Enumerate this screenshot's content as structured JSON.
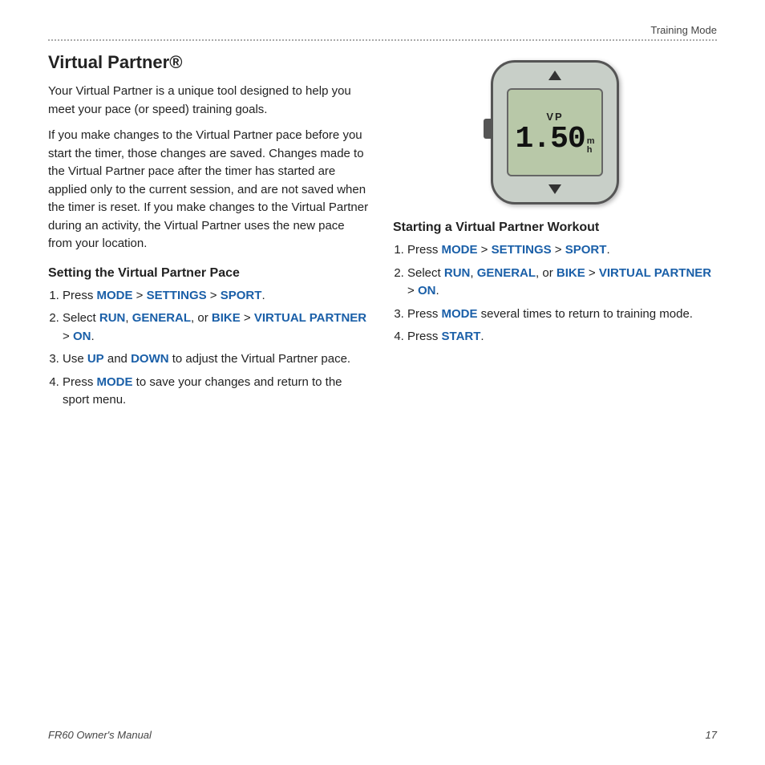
{
  "header": {
    "training_mode": "Training Mode"
  },
  "title": "Virtual Partner®",
  "intro_paragraphs": [
    "Your Virtual Partner is a unique tool designed to help you meet your pace (or speed) training goals.",
    "If you make changes to the Virtual Partner pace before you start the timer, those changes are saved. Changes made to the Virtual Partner pace after the timer has started are applied only to the current session, and are not saved when the timer is reset. If you make changes to the Virtual Partner during an activity, the Virtual Partner uses the new pace from your location."
  ],
  "section1": {
    "heading": "Setting the Virtual Partner Pace",
    "steps": [
      {
        "text_parts": [
          "Press ",
          "MODE",
          " > ",
          "SETTINGS",
          " > ",
          "SPORT",
          "."
        ]
      },
      {
        "text_parts": [
          "Select ",
          "RUN",
          ", ",
          "GENERAL",
          ", or ",
          "BIKE",
          " > ",
          "VIRTUAL PARTNER",
          " > ",
          "ON",
          "."
        ]
      },
      {
        "text_parts": [
          "Use ",
          "UP",
          " and ",
          "DOWN",
          " to adjust the Virtual Partner pace."
        ]
      },
      {
        "text_parts": [
          "Press ",
          "MODE",
          " to save your changes and return to the sport menu."
        ]
      }
    ]
  },
  "section2": {
    "heading": "Starting a Virtual Partner Workout",
    "steps": [
      {
        "text_parts": [
          "Press ",
          "MODE",
          " > ",
          "SETTINGS",
          " > ",
          "SPORT",
          "."
        ]
      },
      {
        "text_parts": [
          "Select ",
          "RUN",
          ", ",
          "GENERAL",
          ", or ",
          "BIKE",
          " > ",
          "VIRTUAL PARTNER",
          " > ",
          "ON",
          "."
        ]
      },
      {
        "text_parts": [
          "Press ",
          "MODE",
          " several times to return to training mode."
        ]
      },
      {
        "text_parts": [
          "Press ",
          "START",
          "."
        ]
      }
    ]
  },
  "device": {
    "label_vp": "VP",
    "label_number": "1.50",
    "label_unit": "m\nh"
  },
  "footer": {
    "manual": "FR60 Owner's Manual",
    "page": "17"
  }
}
